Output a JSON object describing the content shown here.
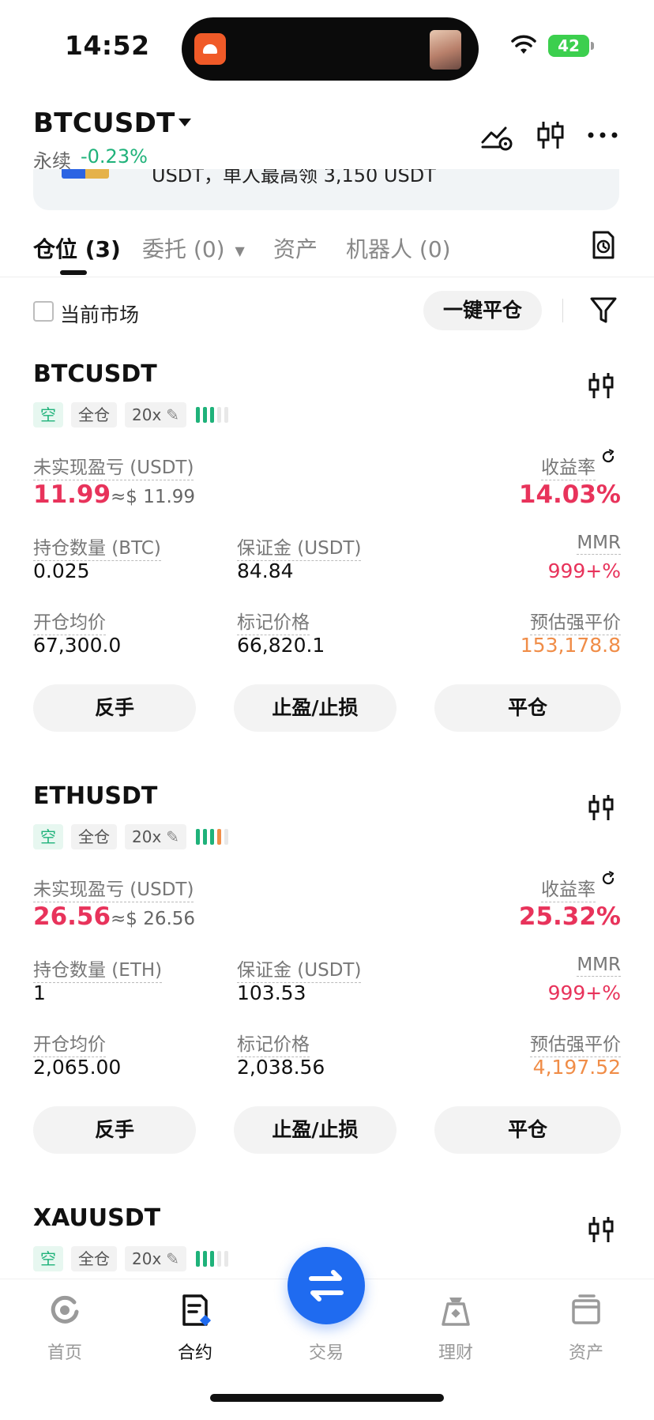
{
  "status_bar": {
    "time": "14:52",
    "battery": "42"
  },
  "header": {
    "pair": "BTCUSDT",
    "market_type": "永续",
    "change": "-0.23%",
    "banner_text": "USDT，单人最高领 3,150 USDT",
    "icons": [
      "strategy-icon",
      "candlestick-icon",
      "more-icon"
    ]
  },
  "tabs": [
    {
      "label": "仓位 (3)",
      "active": true
    },
    {
      "label": "委托 (0)",
      "has_dropdown": true
    },
    {
      "label": "资产"
    },
    {
      "label": "机器人 (0)"
    }
  ],
  "filter": {
    "current_market_label": "当前市场",
    "close_all_label": "一键平仓"
  },
  "positions": [
    {
      "symbol": "BTCUSDT",
      "side": "空",
      "margin_mode": "全仓",
      "leverage": "20x",
      "pnl_label": "未实现盈亏 (USDT)",
      "pnl": "11.99",
      "pnl_usd": "≈$ 11.99",
      "ror_label": "收益率",
      "ror": "14.03%",
      "size_label": "持仓数量 (BTC)",
      "size": "0.025",
      "margin_label": "保证金 (USDT)",
      "margin": "84.84",
      "mmr_label": "MMR",
      "mmr": "999+%",
      "entry_label": "开仓均价",
      "entry": "67,300.0",
      "mark_label": "标记价格",
      "mark": "66,820.1",
      "liq_label": "预估强平价",
      "liq": "153,178.8",
      "btn_reverse": "反手",
      "btn_tpsl": "止盈/止损",
      "btn_close": "平仓"
    },
    {
      "symbol": "ETHUSDT",
      "side": "空",
      "margin_mode": "全仓",
      "leverage": "20x",
      "pnl_label": "未实现盈亏 (USDT)",
      "pnl": "26.56",
      "pnl_usd": "≈$ 26.56",
      "ror_label": "收益率",
      "ror": "25.32%",
      "size_label": "持仓数量 (ETH)",
      "size": "1",
      "margin_label": "保证金 (USDT)",
      "margin": "103.53",
      "mmr_label": "MMR",
      "mmr": "999+%",
      "entry_label": "开仓均价",
      "entry": "2,065.00",
      "mark_label": "标记价格",
      "mark": "2,038.56",
      "liq_label": "预估强平价",
      "liq": "4,197.52",
      "btn_reverse": "反手",
      "btn_tpsl": "止盈/止损",
      "btn_close": "平仓"
    },
    {
      "symbol": "XAUUSDT",
      "side": "空",
      "margin_mode": "全仓",
      "leverage": "20x"
    }
  ],
  "nav": [
    {
      "label": "首页"
    },
    {
      "label": "合约",
      "active": true
    },
    {
      "label": "交易"
    },
    {
      "label": "理财"
    },
    {
      "label": "资产"
    }
  ]
}
